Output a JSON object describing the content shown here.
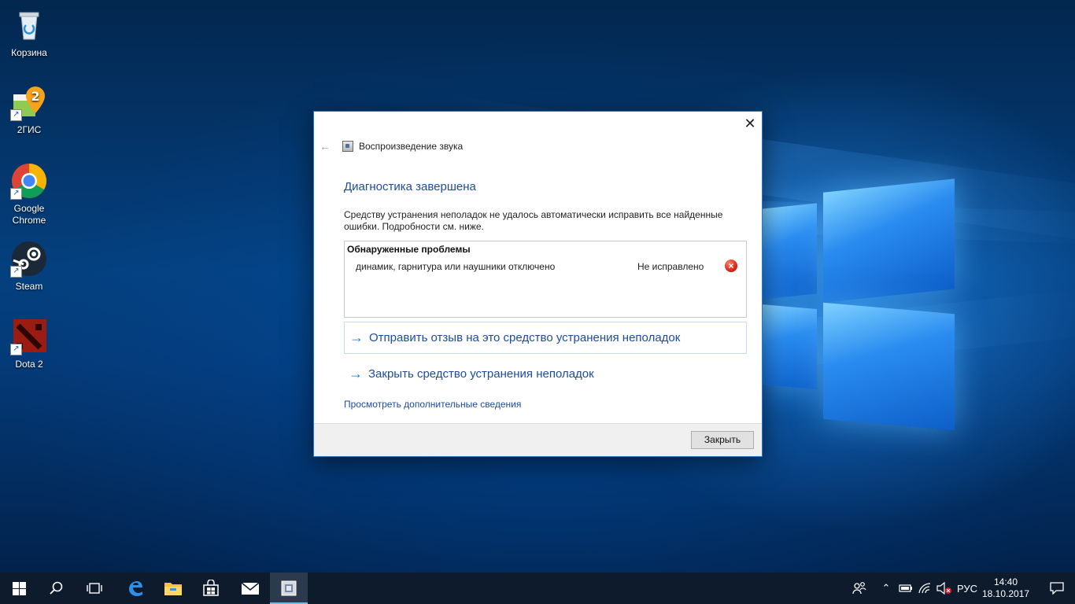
{
  "desktop": {
    "icons": [
      {
        "label": "Корзина",
        "icon": "recycle-bin-icon"
      },
      {
        "label": "2ГИС",
        "icon": "2gis-icon",
        "badge": "2"
      },
      {
        "label": "Google Chrome",
        "icon": "chrome-icon"
      },
      {
        "label": "Steam",
        "icon": "steam-icon"
      },
      {
        "label": "Dota 2",
        "icon": "dota2-icon"
      }
    ]
  },
  "dialog": {
    "title": "Воспроизведение звука",
    "heading": "Диагностика завершена",
    "description": "Средству устранения неполадок не удалось автоматически исправить все найденные ошибки. Подробности см. ниже.",
    "problems": {
      "header": "Обнаруженные проблемы",
      "items": [
        {
          "name": "динамик, гарнитура или наушники отключено",
          "status": "Не исправлено",
          "status_icon": "error-icon"
        }
      ]
    },
    "actions": [
      {
        "label": "Отправить отзыв на это средство устранения неполадок"
      },
      {
        "label": "Закрыть средство устранения неполадок"
      }
    ],
    "more_link": "Просмотреть дополнительные сведения",
    "close_button": "Закрыть",
    "colors": {
      "heading": "#1d4c9c",
      "accent_arrow": "#1d7ad6",
      "error": "#d11c0c"
    }
  },
  "taskbar": {
    "language": "РУС",
    "time": "14:40",
    "date": "18.10.2017",
    "background": "#0d1b2c"
  }
}
